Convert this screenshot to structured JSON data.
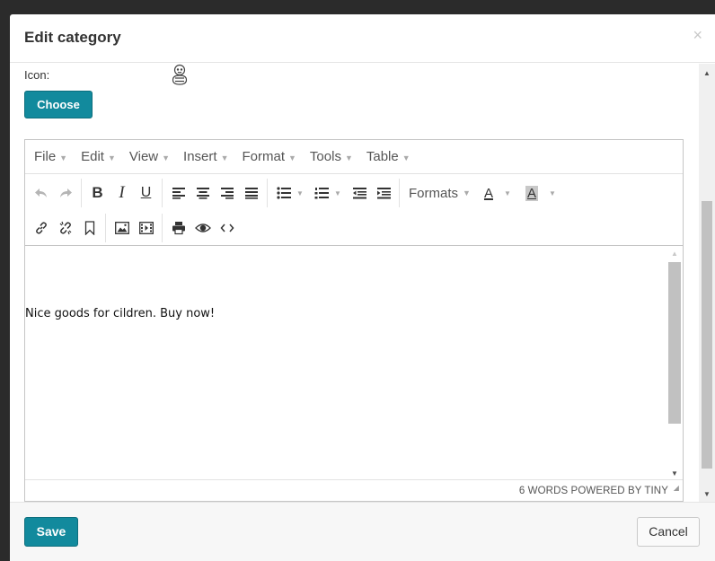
{
  "modal": {
    "title": "Edit category",
    "close_icon": "close-icon",
    "close_glyph": "×"
  },
  "form": {
    "icon_label": "Icon:",
    "icon_preview": "baby-icon",
    "choose_label": "Choose"
  },
  "editor": {
    "menubar": [
      "File",
      "Edit",
      "View",
      "Insert",
      "Format",
      "Tools",
      "Table"
    ],
    "toolbar_row1": [
      [
        "undo-icon",
        "redo-icon"
      ],
      [
        "bold-icon",
        "italic-icon",
        "underline-icon"
      ],
      [
        "align-left-icon",
        "align-center-icon",
        "align-right-icon",
        "align-justify-icon"
      ],
      [
        "bullet-list-icon",
        "numbered-list-icon",
        "outdent-icon",
        "indent-icon"
      ],
      [
        "formats-dropdown",
        "text-color-icon",
        "background-color-icon"
      ]
    ],
    "toolbar_row2": [
      [
        "link-icon",
        "unlink-icon",
        "bookmark-icon"
      ],
      [
        "image-icon",
        "media-icon"
      ],
      [
        "print-icon",
        "preview-icon",
        "code-icon"
      ]
    ],
    "formats_label": "Formats",
    "text_color_letter": "A",
    "bg_color_letter": "A",
    "content": "Nice goods for cildren. Buy now!",
    "status": "6 WORDS POWERED BY TINY"
  },
  "footer": {
    "save_label": "Save",
    "cancel_label": "Cancel"
  },
  "colors": {
    "primary": "#128a9d",
    "backdrop": "#2b2b2b"
  }
}
